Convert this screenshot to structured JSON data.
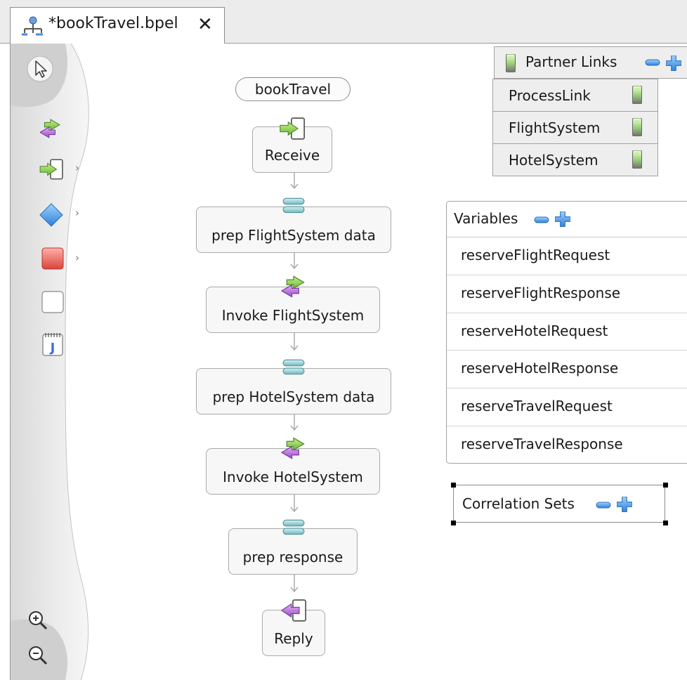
{
  "editor_tab": {
    "title": "*bookTravel.bpel",
    "close_glyph": "✕",
    "icon": "bpel-process-icon"
  },
  "palette": {
    "items": [
      {
        "name": "select-tool-icon"
      },
      {
        "name": "invoke-icon"
      },
      {
        "name": "receive-icon"
      },
      {
        "name": "choice-icon"
      },
      {
        "name": "fault-icon"
      },
      {
        "name": "empty-icon"
      },
      {
        "name": "java-snippet-icon"
      }
    ],
    "zoom_in_icon": "zoom-in-icon",
    "zoom_out_icon": "zoom-out-icon",
    "expand_glyph": "›"
  },
  "process": {
    "name": "bookTravel",
    "activities": [
      {
        "label": "Receive",
        "icon": "receive-icon"
      },
      {
        "label": "prep FlightSystem data",
        "icon": "assign-icon"
      },
      {
        "label": "Invoke FlightSystem",
        "icon": "invoke-icon"
      },
      {
        "label": "prep HotelSystem data",
        "icon": "assign-icon"
      },
      {
        "label": "Invoke HotelSystem",
        "icon": "invoke-icon"
      },
      {
        "label": "prep response",
        "icon": "assign-icon"
      },
      {
        "label": "Reply",
        "icon": "reply-icon"
      }
    ]
  },
  "partner_links": {
    "title": "Partner Links",
    "items": [
      "ProcessLink",
      "FlightSystem",
      "HotelSystem"
    ]
  },
  "variables": {
    "title": "Variables",
    "items": [
      "reserveFlightRequest",
      "reserveFlightResponse",
      "reserveHotelRequest",
      "reserveHotelResponse",
      "reserveTravelRequest",
      "reserveTravelResponse"
    ]
  },
  "correlation_sets": {
    "title": "Correlation Sets"
  },
  "colors": {
    "canvas": "#ffffff",
    "palette": "#e6e6e6",
    "node_fill": "#f7f7f7",
    "node_border": "#a9a9a9",
    "invoke_green": "#8fd14f",
    "invoke_purple": "#b06ad8",
    "add_blue": "#3b8fe0",
    "assign_teal": "#8fcfd4",
    "fault_red": "#e85a4f"
  }
}
